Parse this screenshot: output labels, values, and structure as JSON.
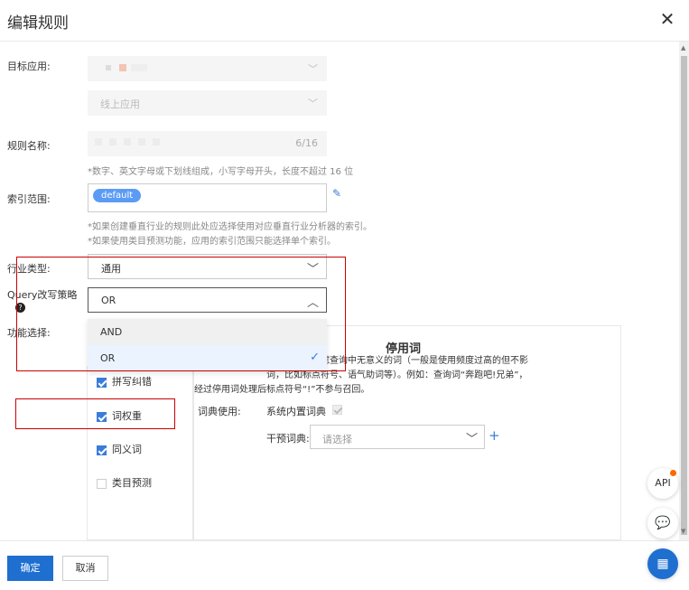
{
  "dialog": {
    "title": "编辑规则"
  },
  "form": {
    "target_app_label": "目标应用:",
    "target_app_placeholder": "",
    "env_value": "线上应用",
    "rule_name_label": "规则名称:",
    "rule_name_counter": "6/16",
    "rule_name_hint": "*数字、英文字母或下划线组成，小写字母开头，长度不超过 16 位",
    "index_range_label": "索引范围:",
    "index_tag": "default",
    "index_hint_1": "*如果创建垂直行业的规则此处应选择使用对应垂直行业分析器的索引。",
    "index_hint_2": "*如果使用类目预测功能，应用的索引范围只能选择单个索引。",
    "industry_label": "行业类型:",
    "industry_value": "通用",
    "query_label": "Query改写策略",
    "query_value": "OR",
    "query_options": [
      "AND",
      "OR"
    ],
    "func_label": "功能选择:"
  },
  "functions": [
    {
      "label": "拼写纠错",
      "checked": true
    },
    {
      "label": "词权重",
      "checked": true
    },
    {
      "label": "同义词",
      "checked": true
    },
    {
      "label": "类目预测",
      "checked": false
    }
  ],
  "panel": {
    "title": "停用词",
    "desc_line1": "的停用词典过滤查询中无意义的词（一般是使用频度过高的但不影",
    "desc_line2": "词，比如标点符号、语气助词等）。例如：查询词“奔跑吧!兄弟”，",
    "desc_line3": "经过停用词处理后标点符号“!”不参与召回。",
    "dict_use_label": "词典使用:",
    "system_dict_label": "系统内置词典",
    "intervene_label": "干预词典:",
    "intervene_placeholder": "请选择"
  },
  "footer": {
    "ok": "确定",
    "cancel": "取消"
  },
  "float": {
    "api": "API"
  }
}
